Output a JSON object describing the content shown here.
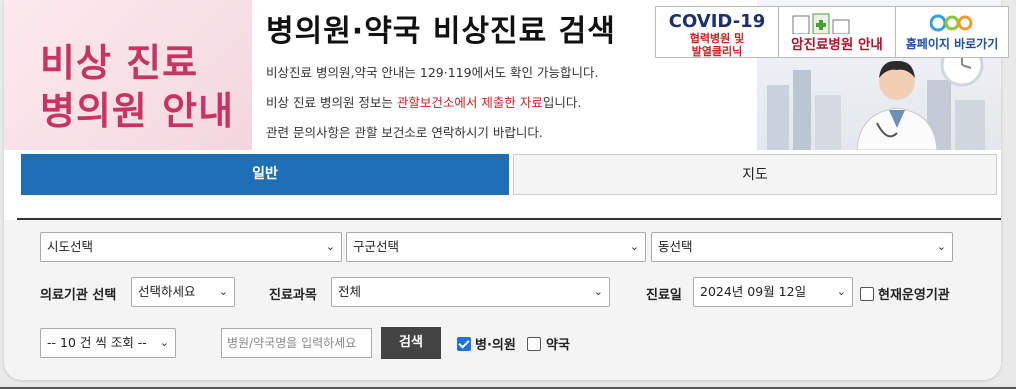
{
  "banner": {
    "left_line1": "비상 진료",
    "left_line2": "병의원 안내"
  },
  "header": {
    "title": "병의원·약국 비상진료 검색",
    "info1": "비상진료 병의원,약국 안내는 129·119에서도 확인 가능합니다.",
    "info2_pre": "비상 진료 병의원 정보는 ",
    "info2_red": "관할보건소에서 제출한 자료",
    "info2_post": "입니다.",
    "info3": "관련 문의사항은 관할 보건소로 연락하시기 바랍니다."
  },
  "badges": {
    "covid_title": "COVID-19",
    "covid_sub1": "협력병원 및",
    "covid_sub2": "발열클리닉",
    "cancer_title": "암진료병원 안내",
    "home_title": "홈페이지 바로가기"
  },
  "tabs": {
    "general": "일반",
    "map": "지도"
  },
  "form": {
    "sido": "시도선택",
    "gugun": "구군선택",
    "dong": "동선택",
    "institution_label": "의료기관 선택",
    "institution_value": "선택하세요",
    "department_label": "진료과목",
    "department_value": "전체",
    "date_label": "진료일",
    "date_value": "2024년 09월 12일",
    "operating_label": "현재운영기관",
    "page_size": "-- 10 건 씩 조회 --",
    "search_placeholder": "병원/약국명을 입력하세요",
    "search_button": "검색",
    "hospital_label": "병·의원",
    "pharmacy_label": "약국",
    "hospital_checked": true,
    "pharmacy_checked": false,
    "operating_checked": false
  },
  "colors": {
    "accent": "#1f6fb6",
    "banner_pink": "#c63561",
    "notice_red": "#d02020"
  }
}
